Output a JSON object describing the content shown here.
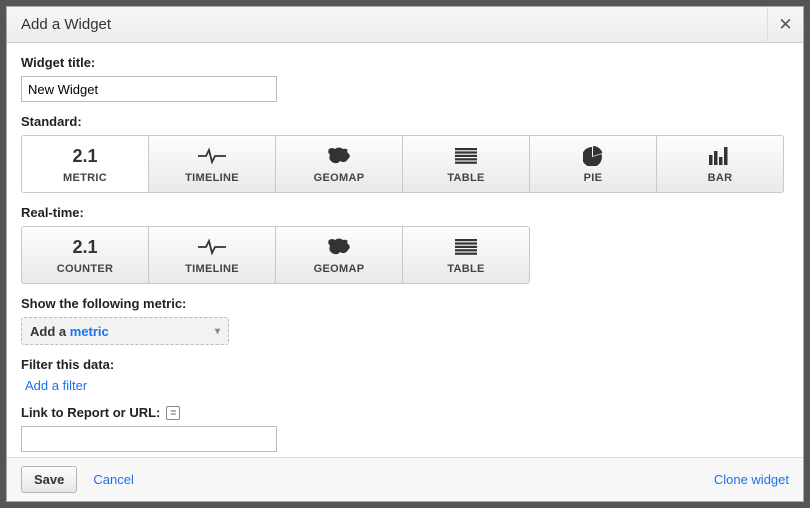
{
  "dialog": {
    "title": "Add a Widget"
  },
  "widgetTitle": {
    "label": "Widget title:",
    "value": "New Widget"
  },
  "standard": {
    "label": "Standard:",
    "tiles": [
      {
        "caption": "METRIC",
        "iconText": "2.1"
      },
      {
        "caption": "TIMELINE"
      },
      {
        "caption": "GEOMAP"
      },
      {
        "caption": "TABLE"
      },
      {
        "caption": "PIE"
      },
      {
        "caption": "BAR"
      }
    ],
    "selectedIndex": 0
  },
  "realtime": {
    "label": "Real-time:",
    "tiles": [
      {
        "caption": "COUNTER",
        "iconText": "2.1"
      },
      {
        "caption": "TIMELINE"
      },
      {
        "caption": "GEOMAP"
      },
      {
        "caption": "TABLE"
      }
    ]
  },
  "metric": {
    "label": "Show the following metric:",
    "dropdown_prefix": "Add a ",
    "dropdown_link": "metric"
  },
  "filter": {
    "label": "Filter this data:",
    "linkText": "Add a filter"
  },
  "linkReport": {
    "label": "Link to Report or URL:",
    "value": ""
  },
  "footer": {
    "save": "Save",
    "cancel": "Cancel",
    "clone": "Clone widget"
  }
}
